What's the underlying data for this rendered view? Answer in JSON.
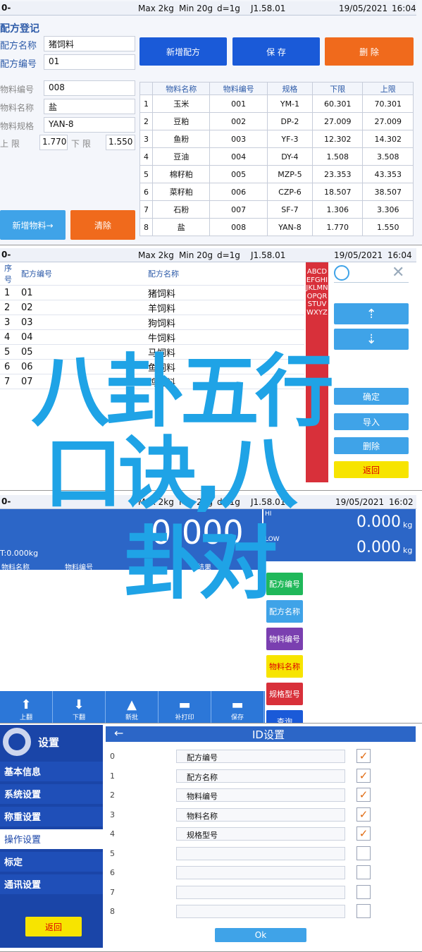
{
  "status": {
    "battery": "0-",
    "max": "Max 2kg",
    "min": "Min 20g",
    "d": "d=1g",
    "ver": "J1.58.01",
    "date": "19/05/2021",
    "time1": "16:04",
    "time3": "16:02"
  },
  "screen1": {
    "title": "配方登记",
    "recipe_name_label": "配方名称",
    "recipe_name": "猪饲料",
    "recipe_no_label": "配方编号",
    "recipe_no": "01",
    "material_no_label": "物料编号",
    "material_no": "008",
    "material_name_label": "物料名称",
    "material_name": "盐",
    "material_spec_label": "物料规格",
    "material_spec": "YAN-8",
    "upper_label": "上 限",
    "upper": "1.770",
    "lower_label": "下 限",
    "lower": "1.550",
    "btn_add_recipe": "新增配方",
    "btn_save": "保 存",
    "btn_delete": "删 除",
    "btn_add_material": "新增物料→",
    "btn_clear": "清除",
    "table_headers": [
      "物料名称",
      "物料编号",
      "规格",
      "下限",
      "上限"
    ],
    "rows": [
      [
        "1",
        "玉米",
        "001",
        "YM-1",
        "60.301",
        "70.301"
      ],
      [
        "2",
        "豆粕",
        "002",
        "DP-2",
        "27.009",
        "27.009"
      ],
      [
        "3",
        "鱼粉",
        "003",
        "YF-3",
        "12.302",
        "14.302"
      ],
      [
        "4",
        "豆油",
        "004",
        "DY-4",
        "1.508",
        "3.508"
      ],
      [
        "5",
        "棉籽粕",
        "005",
        "MZP-5",
        "23.353",
        "43.353"
      ],
      [
        "6",
        "菜籽粕",
        "006",
        "CZP-6",
        "18.507",
        "38.507"
      ],
      [
        "7",
        "石粉",
        "007",
        "SF-7",
        "1.306",
        "3.306"
      ],
      [
        "8",
        "盐",
        "008",
        "YAN-8",
        "1.770",
        "1.550"
      ]
    ]
  },
  "screen2": {
    "headers": [
      "序号",
      "配方编号",
      "配方名称"
    ],
    "rows": [
      [
        "1",
        "01",
        "猪饲料"
      ],
      [
        "2",
        "02",
        "羊饲料"
      ],
      [
        "3",
        "03",
        "狗饲料"
      ],
      [
        "4",
        "04",
        "牛饲料"
      ],
      [
        "5",
        "05",
        "马饲料"
      ],
      [
        "6",
        "06",
        "鱼饲料"
      ],
      [
        "7",
        "07",
        "鸡饲料"
      ]
    ],
    "alphabet": "ABCDEFGHIJKLMNOPQRSTUVWXYZ",
    "btn_delete": "删除",
    "btn_back": "返回",
    "btn_import": "导入",
    "btn_confirm": "确定"
  },
  "screen3": {
    "total": "T:0.000kg",
    "big": "0.000",
    "hi": "0.000",
    "hi_unit": "kg",
    "lo": "0.000",
    "lo_unit": "kg",
    "hi_label": "HI",
    "lo_label": "LOW",
    "headers": [
      "物料名称",
      "物料编号",
      "结果"
    ],
    "side_buttons": [
      "配方编号",
      "配方名称",
      "物料编号",
      "物料名称",
      "规格型号",
      "查询"
    ],
    "tools": [
      "上翻",
      "下翻",
      "新批",
      "补打印",
      "保存"
    ]
  },
  "screen4": {
    "sidebar_title": "设置",
    "sidebar": [
      "基本信息",
      "系统设置",
      "称重设置",
      "操作设置",
      "标定",
      "通讯设置"
    ],
    "back": "返回",
    "title": "ID设置",
    "rows": [
      {
        "n": "0",
        "label": "配方编号",
        "checked": true
      },
      {
        "n": "1",
        "label": "配方名称",
        "checked": true
      },
      {
        "n": "2",
        "label": "物料编号",
        "checked": true
      },
      {
        "n": "3",
        "label": "物料名称",
        "checked": true
      },
      {
        "n": "4",
        "label": "规格型号",
        "checked": true
      },
      {
        "n": "5",
        "label": "",
        "checked": false
      },
      {
        "n": "6",
        "label": "",
        "checked": false
      },
      {
        "n": "7",
        "label": "",
        "checked": false
      },
      {
        "n": "8",
        "label": "",
        "checked": false
      }
    ],
    "ok": "Ok"
  },
  "overlay": {
    "line1": "八卦五行",
    "line2": "口诀,八",
    "line3": "卦对"
  },
  "colors": {
    "overlay": "#1fa3e6",
    "primary": "#1a5ad8",
    "orange": "#f06a1c"
  }
}
